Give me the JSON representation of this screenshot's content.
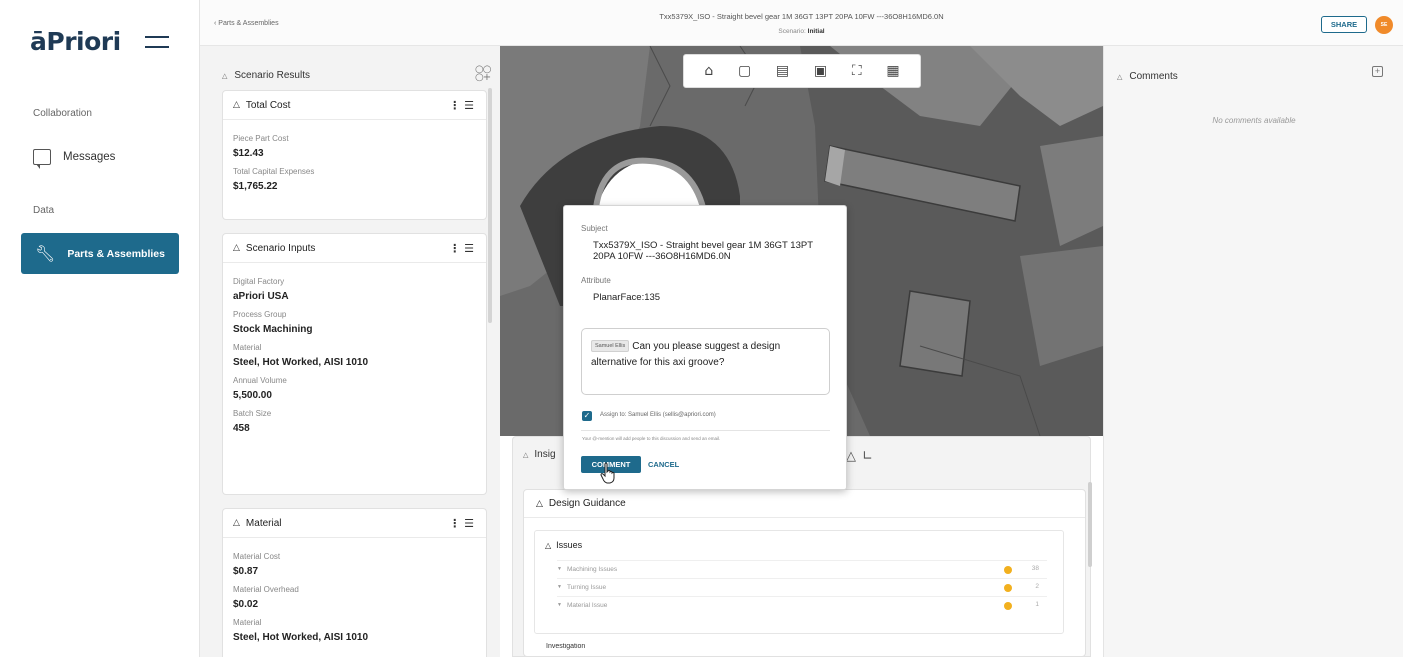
{
  "app": {
    "logo": "āPriori"
  },
  "sidebar": {
    "section_collaboration": "Collaboration",
    "messages_label": "Messages",
    "section_data": "Data",
    "parts_label": "Parts & Assemblies"
  },
  "header": {
    "breadcrumb": "‹  Parts & Assemblies",
    "title": "Txx5379X_ISO - Straight bevel gear 1M 36GT 13PT 20PA 10FW ---36O8H16MD6.0N",
    "scenario_label": "Scenario:",
    "scenario_value": "Initial",
    "share_label": "SHARE",
    "avatar_initials": "SE"
  },
  "scenario_results": {
    "title": "Scenario Results",
    "total_cost": {
      "title": "Total Cost",
      "fields": [
        {
          "label": "Piece Part Cost",
          "value": "$12.43"
        },
        {
          "label": "Total Capital Expenses",
          "value": "$1,765.22"
        }
      ]
    },
    "scenario_inputs": {
      "title": "Scenario Inputs",
      "fields": [
        {
          "label": "Digital Factory",
          "value": "aPriori USA"
        },
        {
          "label": "Process Group",
          "value": "Stock Machining"
        },
        {
          "label": "Material",
          "value": "Steel, Hot Worked, AISI 1010"
        },
        {
          "label": "Annual Volume",
          "value": "5,500.00"
        },
        {
          "label": "Batch Size",
          "value": "458"
        }
      ]
    },
    "material": {
      "title": "Material",
      "fields": [
        {
          "label": "Material Cost",
          "value": "$0.87"
        },
        {
          "label": "Material Overhead",
          "value": "$0.02"
        },
        {
          "label": "Material",
          "value": "Steel, Hot Worked, AISI 1010"
        }
      ]
    }
  },
  "insights": {
    "title": "Insig",
    "design_guidance": {
      "title": "Design Guidance",
      "issues_title": "Issues",
      "rows": [
        {
          "label": "Machining Issues",
          "count": "38"
        },
        {
          "label": "Turning Issue",
          "count": "2"
        },
        {
          "label": "Material Issue",
          "count": "1"
        }
      ],
      "investigation_title": "Investigation"
    }
  },
  "comments": {
    "title": "Comments",
    "empty_text": "No comments available"
  },
  "modal": {
    "subject_label": "Subject",
    "subject_value": "Txx5379X_ISO - Straight bevel gear 1M 36GT 13PT 20PA 10FW ---36O8H16MD6.0N",
    "attribute_label": "Attribute",
    "attribute_value": "PlanarFace:135",
    "mention_chip": "Samuel Ellis",
    "comment_text": "Can you please suggest a design alternative for this axi groove?",
    "assign_text": "Assign to: Samuel Ellis (sellis@apriori.com)",
    "note_text": "Your @-mention will add people to this discussion and send an email.",
    "comment_button": "COMMENT",
    "cancel_button": "CANCEL"
  },
  "colors": {
    "primary": "#1e6a8c",
    "logo": "#1f3a55",
    "warning": "#f2b01e",
    "avatar": "#f08a2a"
  }
}
